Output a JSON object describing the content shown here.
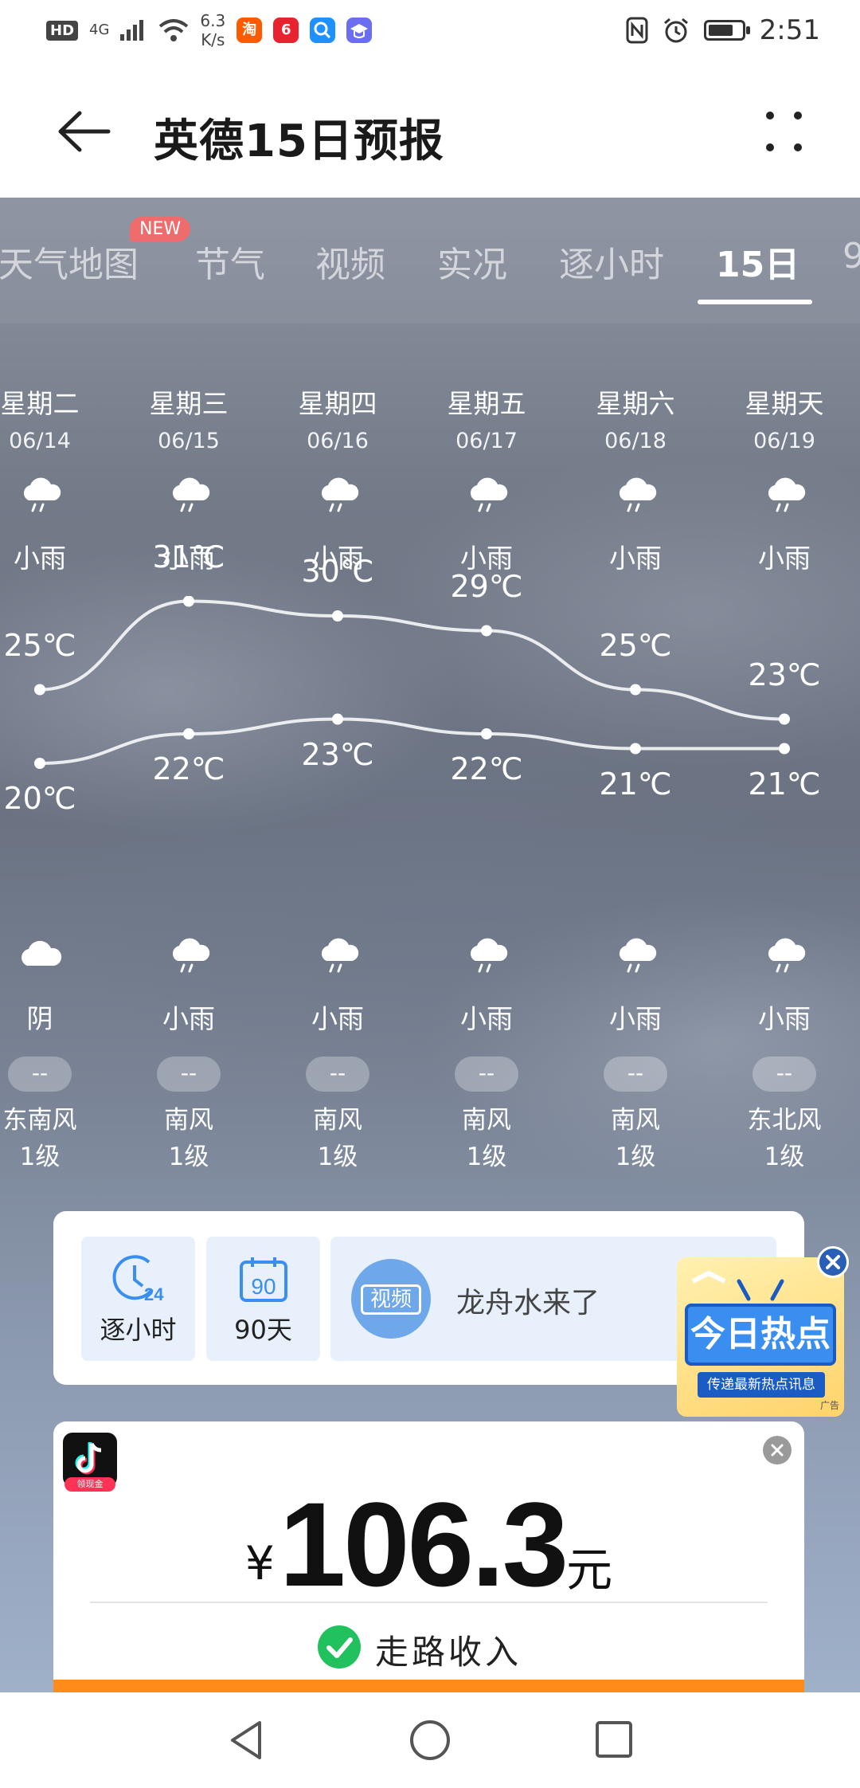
{
  "status_bar": {
    "hd": "HD",
    "network": "4G",
    "speed_value": "6.3",
    "speed_unit": "K/s",
    "time": "2:51",
    "battery_level": 0.75,
    "icons": [
      "signal-icon",
      "wifi-icon",
      "taobao-icon",
      "618-app-icon",
      "search-app-icon",
      "study-app-icon",
      "nfc-icon",
      "alarm-icon",
      "battery-icon"
    ]
  },
  "header": {
    "title": "英德15日预报"
  },
  "tabs": [
    {
      "label": "天气地图"
    },
    {
      "label": "节气"
    },
    {
      "label": "视频"
    },
    {
      "label": "实况"
    },
    {
      "label": "逐小时"
    },
    {
      "label": "15日"
    },
    {
      "label": "9"
    }
  ],
  "new_badge": "NEW",
  "days": [
    {
      "weekday": "星期二",
      "date": "06/14",
      "day_cond": "小雨",
      "night_cond": "阴",
      "high": "25℃",
      "low": "20℃",
      "aqi": "--",
      "wind_dir": "东南风",
      "wind_level": "1级"
    },
    {
      "weekday": "星期三",
      "date": "06/15",
      "day_cond": "小雨",
      "night_cond": "小雨",
      "high": "31℃",
      "low": "22℃",
      "aqi": "--",
      "wind_dir": "南风",
      "wind_level": "1级"
    },
    {
      "weekday": "星期四",
      "date": "06/16",
      "day_cond": "小雨",
      "night_cond": "小雨",
      "high": "30℃",
      "low": "23℃",
      "aqi": "--",
      "wind_dir": "南风",
      "wind_level": "1级"
    },
    {
      "weekday": "星期五",
      "date": "06/17",
      "day_cond": "小雨",
      "night_cond": "小雨",
      "high": "29℃",
      "low": "22℃",
      "aqi": "--",
      "wind_dir": "南风",
      "wind_level": "1级"
    },
    {
      "weekday": "星期六",
      "date": "06/18",
      "day_cond": "小雨",
      "night_cond": "小雨",
      "high": "25℃",
      "low": "21℃",
      "aqi": "--",
      "wind_dir": "南风",
      "wind_level": "1级"
    },
    {
      "weekday": "星期天",
      "date": "06/19",
      "day_cond": "小雨",
      "night_cond": "小雨",
      "high": "23℃",
      "low": "21℃",
      "aqi": "--",
      "wind_dir": "东北风",
      "wind_level": "1级"
    }
  ],
  "chart_data": {
    "type": "line",
    "x": [
      "06/14",
      "06/15",
      "06/16",
      "06/17",
      "06/18",
      "06/19"
    ],
    "series": [
      {
        "values": [
          25,
          31,
          30,
          29,
          25,
          23
        ]
      },
      {
        "values": [
          20,
          22,
          23,
          22,
          21,
          21
        ]
      }
    ],
    "ylabel": "",
    "unit": "℃"
  },
  "shortcuts": {
    "hourly": {
      "label": "逐小时",
      "icon_text": "24"
    },
    "ninety": {
      "label": "90天",
      "icon_text": "90"
    }
  },
  "video_banner": {
    "badge": "视频",
    "text": "龙舟水来了"
  },
  "hot_ad": {
    "title": "今日热点",
    "subtitle": "传递最新热点讯息",
    "tag": "广告"
  },
  "money_card": {
    "currency": "¥",
    "amount": "106.3",
    "unit": "元",
    "label": "走路收入",
    "tag": "领现金"
  },
  "colors": {
    "accent_blue": "#3a8ef0",
    "check_green": "#21c15d",
    "orange": "#ff8c1a",
    "badge_red": "#f06b6b"
  }
}
